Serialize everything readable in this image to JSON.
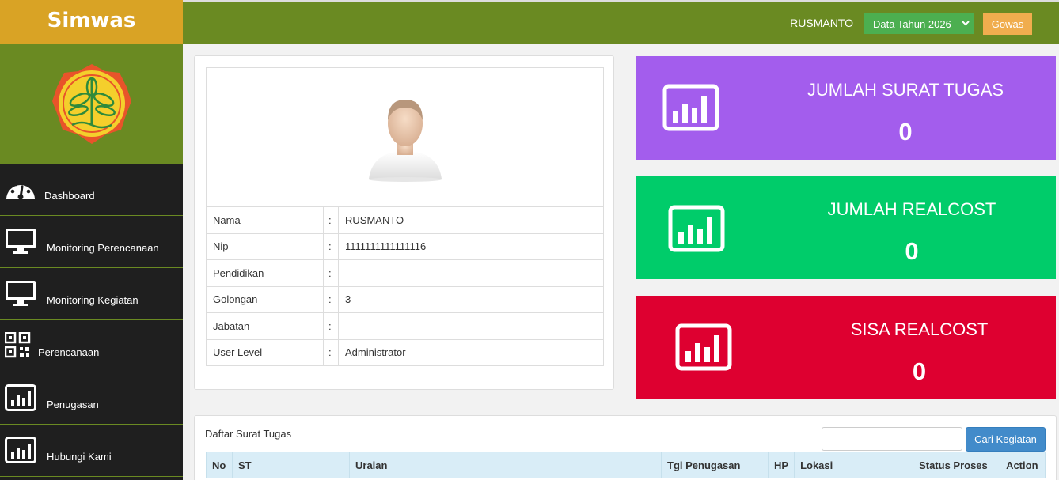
{
  "app": {
    "brand": "Simwas"
  },
  "topbar": {
    "username": "RUSMANTO",
    "year_selected": "Data Tahun 2026",
    "gowas_label": "Gowas"
  },
  "sidebar": {
    "items": [
      {
        "label": "Dashboard",
        "icon": "dashboard-gauge-icon"
      },
      {
        "label": "Monitoring Perencanaan",
        "icon": "monitor-icon"
      },
      {
        "label": "Monitoring Kegiatan",
        "icon": "monitor-icon"
      },
      {
        "label": "Perencanaan",
        "icon": "qr-code-icon"
      },
      {
        "label": "Penugasan",
        "icon": "bar-chart-icon"
      },
      {
        "label": "Hubungi Kami",
        "icon": "bar-chart-icon"
      }
    ]
  },
  "profile": {
    "rows": [
      {
        "label": "Nama",
        "sep": ":",
        "value": "RUSMANTO"
      },
      {
        "label": "Nip",
        "sep": ":",
        "value": "1111111111111116"
      },
      {
        "label": "Pendidikan",
        "sep": ":",
        "value": ""
      },
      {
        "label": "Golongan",
        "sep": ":",
        "value": "3"
      },
      {
        "label": "Jabatan",
        "sep": ":",
        "value": ""
      },
      {
        "label": "User Level",
        "sep": ":",
        "value": "Administrator"
      }
    ]
  },
  "cards": [
    {
      "title": "JUMLAH SURAT TUGAS",
      "value": "0",
      "color": "#a35ded"
    },
    {
      "title": "JUMLAH REALCOST",
      "value": "0",
      "color": "#00cc6a"
    },
    {
      "title": "SISA REALCOST",
      "value": "0",
      "color": "#de0030"
    }
  ],
  "surat_tugas": {
    "title": "Daftar Surat Tugas",
    "search_button": "Cari Kegiatan",
    "columns": [
      "No",
      "ST",
      "Uraian",
      "Tgl Penugasan",
      "HP",
      "Lokasi",
      "Status Proses",
      "Action"
    ]
  },
  "colors": {
    "brand": "#d9a325",
    "olive": "#6a8a22",
    "sidebar": "#1f1f1f",
    "primary": "#428bca",
    "warning": "#f0ad4e",
    "success": "#4caf50"
  }
}
